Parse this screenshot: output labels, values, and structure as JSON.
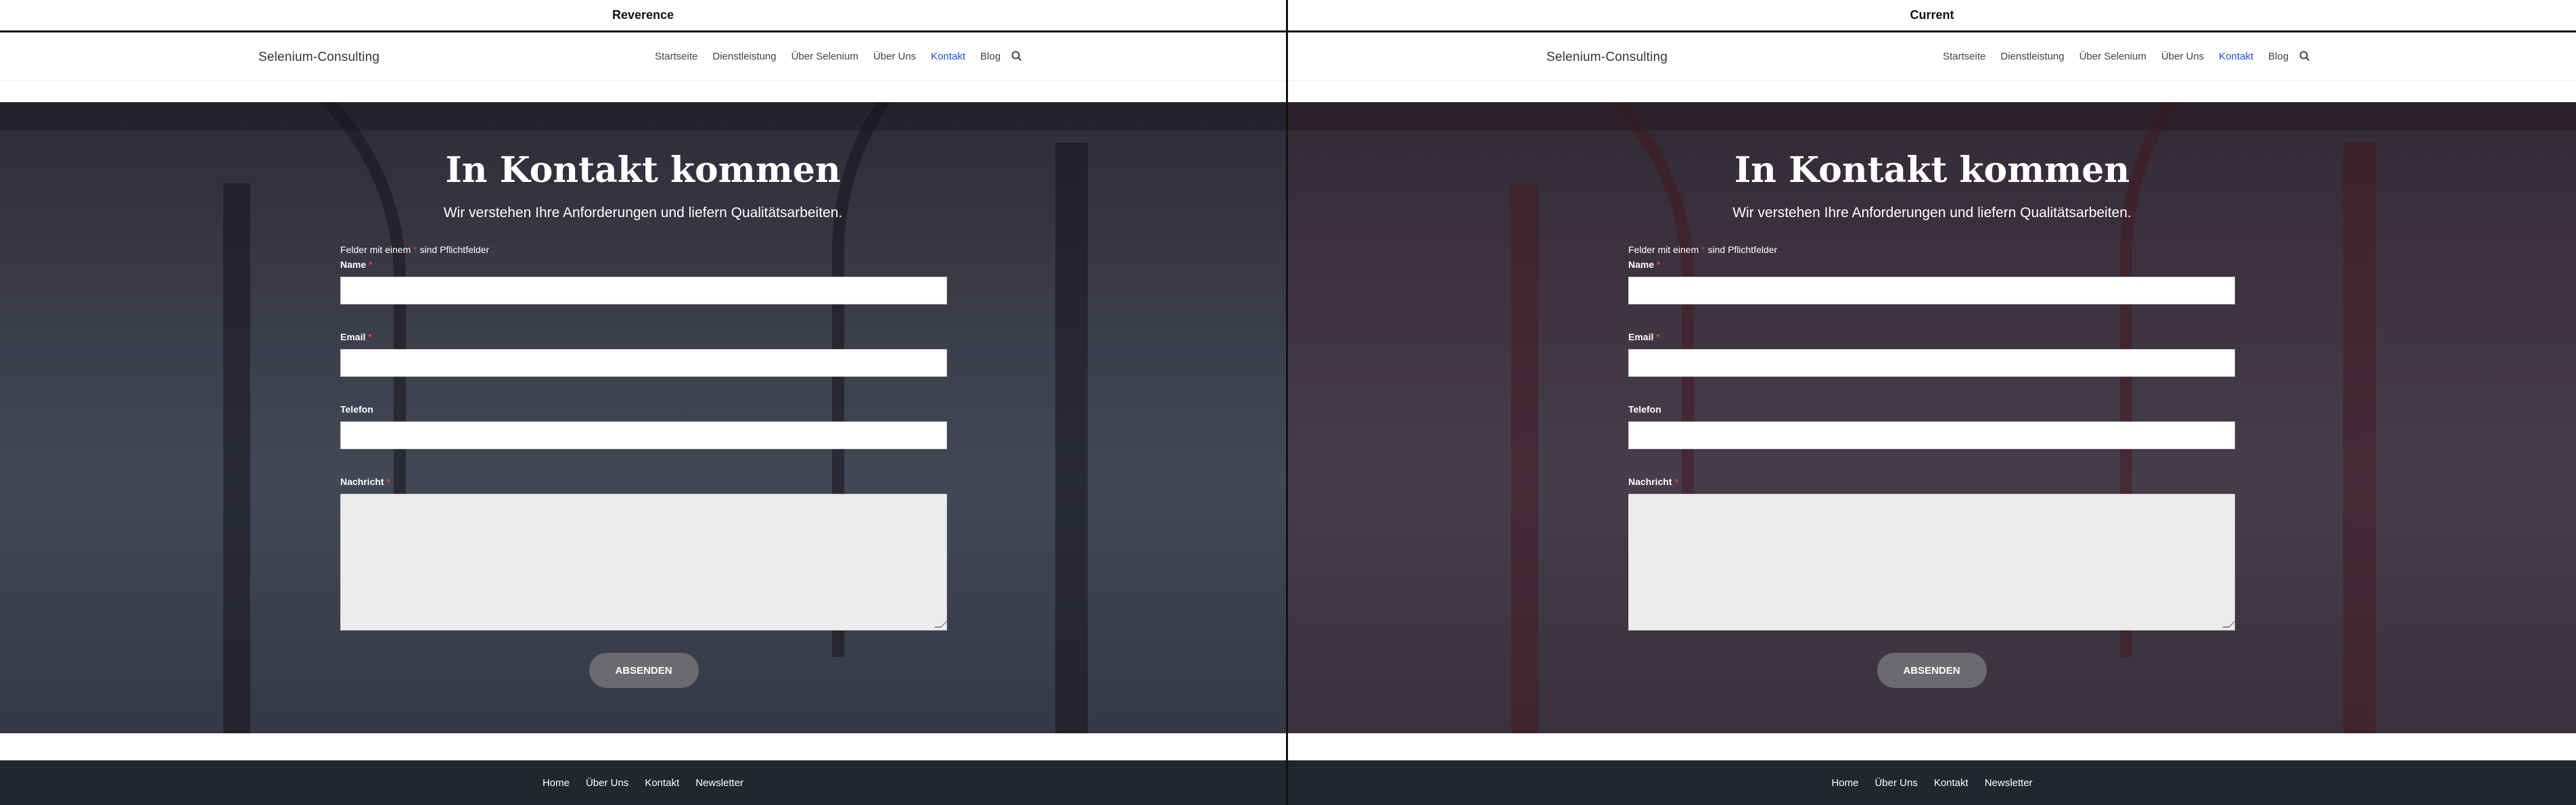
{
  "panels": [
    {
      "title": "Reverence",
      "nav": {
        "logo": "Selenium-Consulting",
        "items": [
          "Startseite",
          "Dienstleistung",
          "Über Selenium",
          "Über Uns",
          "Kontakt",
          "Blog"
        ],
        "active": "Kontakt"
      },
      "hero": {
        "title": "In Kontakt kommen",
        "subtitle": "Wir verstehen Ihre Anforderungen und liefern Qualitätsarbeiten."
      },
      "form": {
        "required_note_prefix": "Felder mit einem",
        "required_note_star": "*",
        "required_note_suffix": "sind Pflichtfelder",
        "fields": [
          {
            "label": "Name",
            "required": "*"
          },
          {
            "label": "Email",
            "required": "*"
          },
          {
            "label": "Telefon",
            "required": ""
          }
        ],
        "message_label": "Nachricht",
        "message_required": "*",
        "submit": "ABSENDEN"
      },
      "footer": [
        "Home",
        "Über Uns",
        "Kontakt",
        "Newsletter"
      ]
    },
    {
      "title": "Current",
      "nav": {
        "logo": "Selenium-Consulting",
        "items": [
          "Startseite",
          "Dienstleistung",
          "Über Selenium",
          "Über Uns",
          "Kontakt",
          "Blog"
        ],
        "active": "Kontakt"
      },
      "hero": {
        "title": "In Kontakt kommen",
        "subtitle": "Wir verstehen Ihre Anforderungen und liefern Qualitätsarbeiten."
      },
      "form": {
        "required_note_prefix": "Felder mit einem",
        "required_note_star": "*",
        "required_note_suffix": "sind Pflichtfelder",
        "fields": [
          {
            "label": "Name",
            "required": "*"
          },
          {
            "label": "Email",
            "required": "*"
          },
          {
            "label": "Telefon",
            "required": ""
          }
        ],
        "message_label": "Nachricht",
        "message_required": "*",
        "submit": "ABSENDEN"
      },
      "footer": [
        "Home",
        "Über Uns",
        "Kontakt",
        "Newsletter"
      ]
    }
  ],
  "colors": {
    "accent": "#1e4ee0",
    "required": "#e0424a",
    "footer": "#22272d",
    "button": "#6b6b6f"
  }
}
